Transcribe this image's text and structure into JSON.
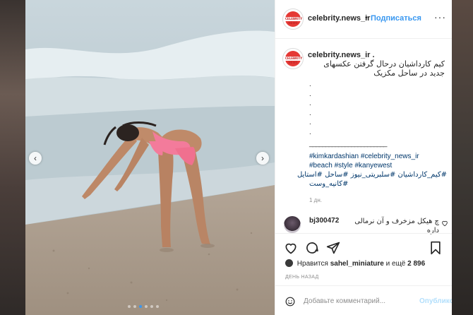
{
  "post": {
    "username": "celebrity.news_ir",
    "separator": "•",
    "follow_label": "Подписаться",
    "more_label": "···",
    "avatar_text": "CELEBRITY NEWS"
  },
  "caption": {
    "username": "celebrity.news_ir .",
    "text": "کیم کارداشیان درحال گرفتن عکسهای جدید در ساحل مکزیک",
    "dots": ". . . . . .",
    "rule": "________________________",
    "hashtags": [
      "#kimkardashian #celebrity_news_ir",
      "#beach #style #kanyewest",
      "#کیم_کارداشیان #سلبریتی_نیوز #ساحل #استایل",
      "#کانیه_وست"
    ],
    "time": "1 дн."
  },
  "comment": {
    "username": "bj300472",
    "text": "چ هیکل مزخرف و آن نرمالی داره"
  },
  "icons": {
    "heart": "heart-icon",
    "comment": "comment-icon",
    "share": "share-icon",
    "bookmark": "bookmark-icon",
    "emoji": "emoji-icon",
    "more": "more-icon"
  },
  "likes": {
    "prefix": "Нравится",
    "user": "sahel_miniature",
    "middle": "и ещё",
    "count": "2 896"
  },
  "date": "ДЕНЬ НАЗАД",
  "add_comment": {
    "placeholder": "Добавьте комментарий...",
    "post_label": "Опубликовать"
  },
  "carousel": {
    "prev": "‹",
    "next": "›",
    "slides": 6,
    "active": 2
  },
  "colors": {
    "link": "#3897f0",
    "hashtag": "#00376b",
    "muted": "#8e8e8e"
  }
}
